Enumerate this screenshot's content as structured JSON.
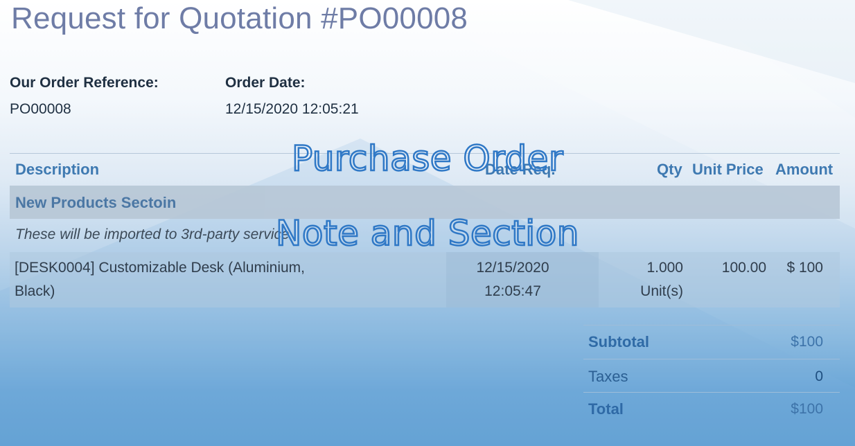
{
  "document": {
    "title": "Request for Quotation #PO00008",
    "order_reference_label": "Our Order Reference:",
    "order_reference_value": "PO00008",
    "order_date_label": "Order Date:",
    "order_date_value": "12/15/2020 12:05:21"
  },
  "table": {
    "headers": {
      "description": "Description",
      "date_partial": "Date Req.",
      "qty": "Qty",
      "unit_price": "Unit Price",
      "amount": "Amount"
    },
    "section_label": "New Products Sectoin",
    "note_text": "These will be imported to 3rd-party service",
    "line": {
      "description_line1": "[DESK0004] Customizable Desk (Aluminium,",
      "description_line2": "Black)",
      "date_line1": "12/15/2020",
      "date_line2": "12:05:47",
      "qty_line1": "1.000",
      "qty_line2": "Unit(s)",
      "unit_price": "100.00",
      "amount": "$ 100"
    }
  },
  "totals": {
    "subtotal_label": "Subtotal",
    "subtotal_value": "$100",
    "taxes_label": "Taxes",
    "taxes_value": "0",
    "total_label": "Total",
    "total_value": "$100"
  },
  "overlay": {
    "line1": "Purchase Order",
    "line2": "Note and Section"
  }
}
